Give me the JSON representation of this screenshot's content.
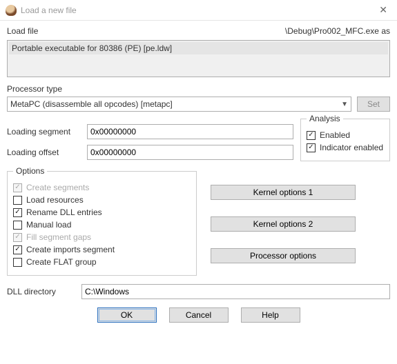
{
  "window": {
    "title": "Load a new file"
  },
  "loadfile": {
    "label": "Load file",
    "path": "\\Debug\\Pro002_MFC.exe as",
    "selected": "Portable executable for 80386 (PE) [pe.ldw]"
  },
  "processor": {
    "label": "Processor type",
    "value": "MetaPC (disassemble all opcodes) [metapc]",
    "set_btn": "Set"
  },
  "segments": {
    "loading_segment_label": "Loading segment",
    "loading_segment_value": "0x00000000",
    "loading_offset_label": "Loading offset",
    "loading_offset_value": "0x00000000"
  },
  "analysis": {
    "legend": "Analysis",
    "enabled_label": "Enabled",
    "enabled": true,
    "indicator_label": "Indicator enabled",
    "indicator": true
  },
  "options": {
    "legend": "Options",
    "create_segments": {
      "label": "Create segments",
      "checked": true,
      "disabled": true
    },
    "load_resources": {
      "label": "Load resources",
      "checked": false
    },
    "rename_dll": {
      "label": "Rename DLL entries",
      "checked": true
    },
    "manual_load": {
      "label": "Manual load",
      "checked": false
    },
    "fill_gaps": {
      "label": "Fill segment gaps",
      "checked": true,
      "disabled": true
    },
    "create_imports": {
      "label": "Create imports segment",
      "checked": true
    },
    "create_flat": {
      "label": "Create FLAT group",
      "checked": false
    }
  },
  "buttons": {
    "kernel1": "Kernel options 1",
    "kernel2": "Kernel options 2",
    "procopts": "Processor options"
  },
  "dlldir": {
    "label": "DLL directory",
    "value": "C:\\Windows"
  },
  "footer": {
    "ok": "OK",
    "cancel": "Cancel",
    "help": "Help"
  }
}
